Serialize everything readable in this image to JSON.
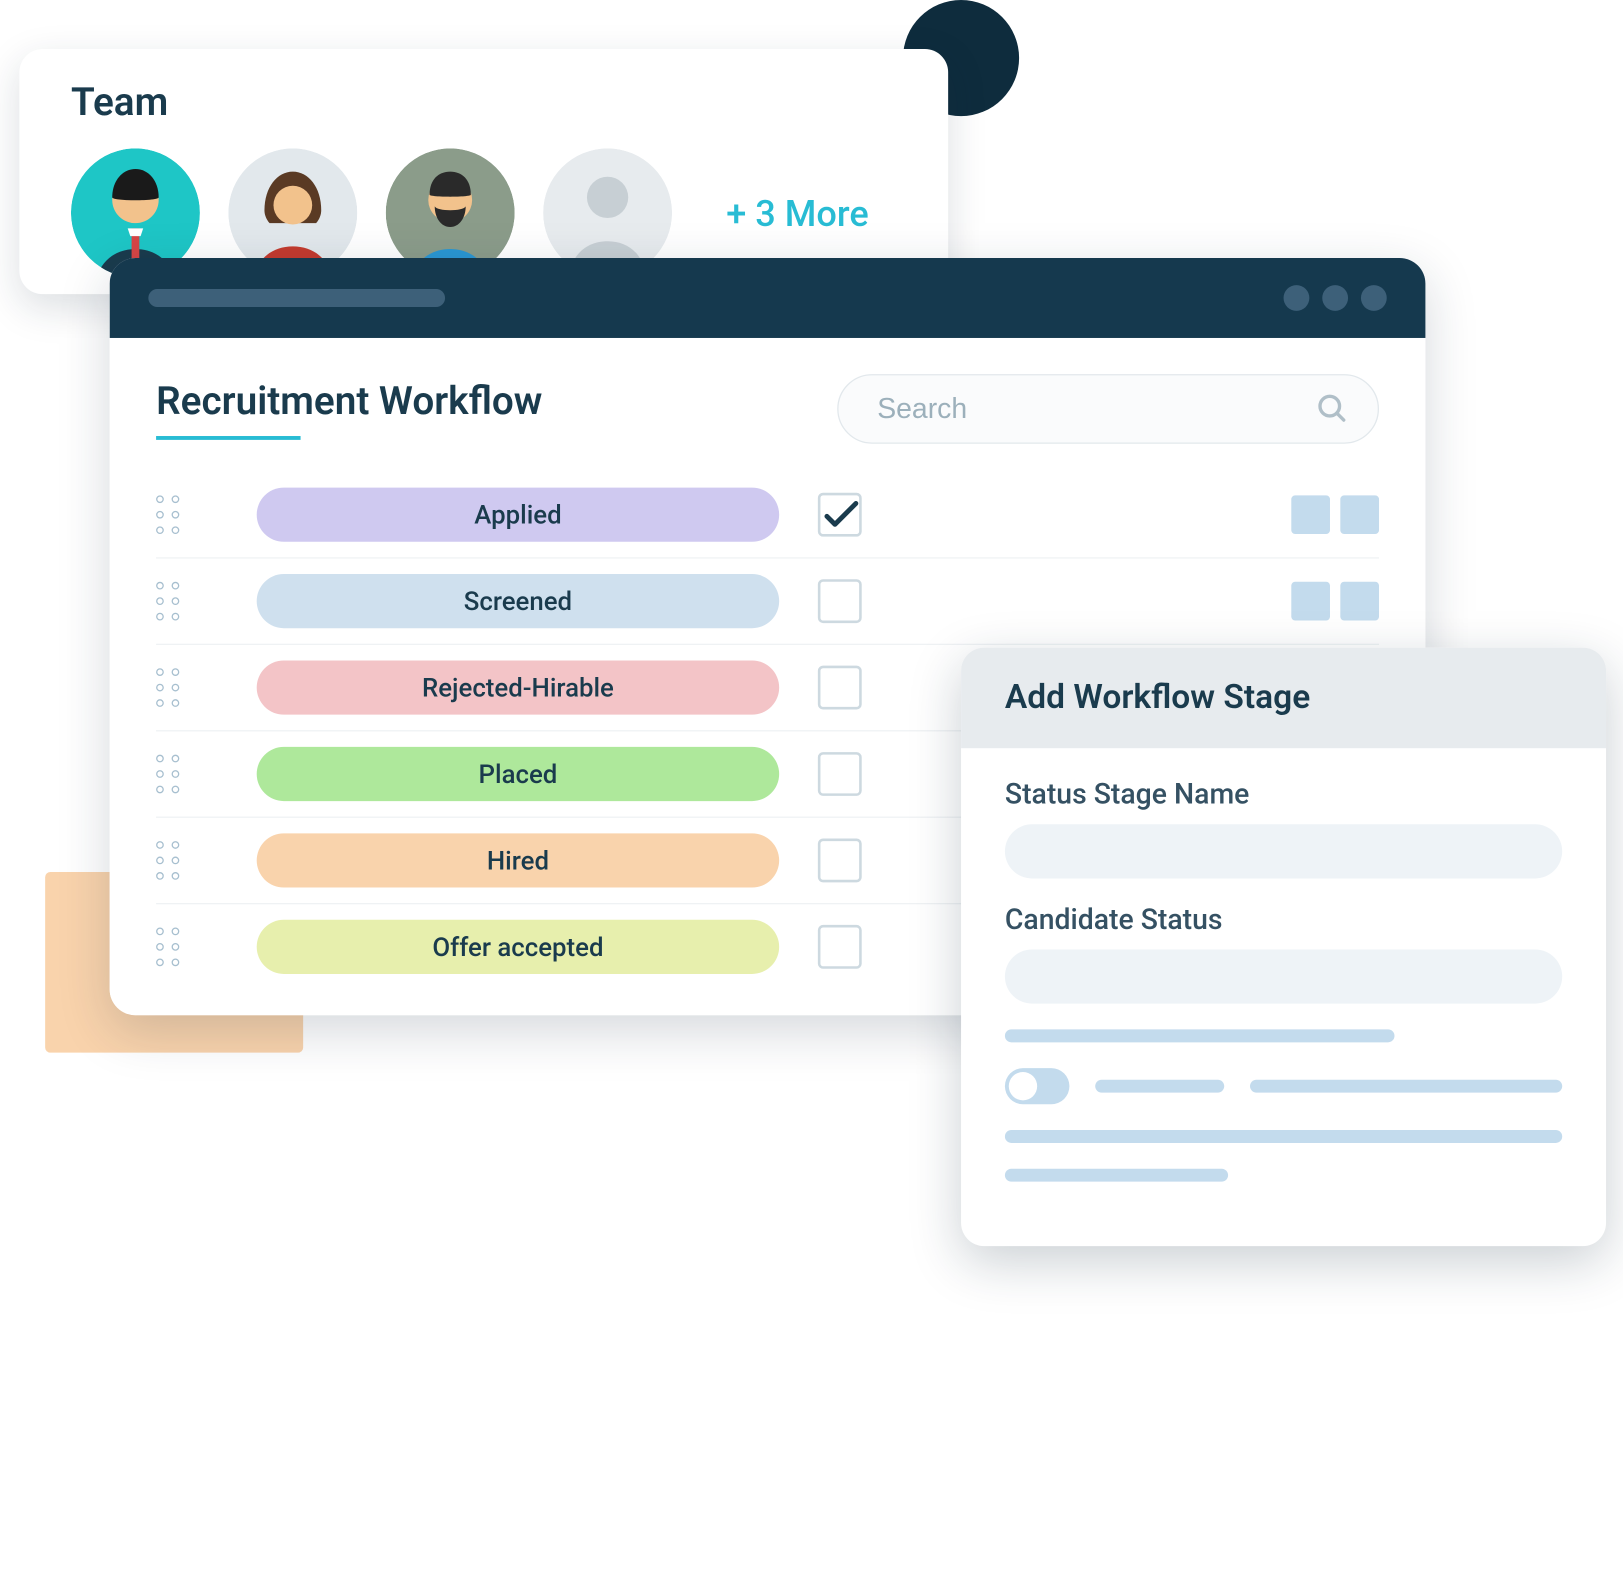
{
  "team": {
    "title": "Team",
    "more_label": "+ 3 More"
  },
  "workflow": {
    "title": "Recruitment Workflow",
    "search_placeholder": "Search",
    "stages": [
      {
        "label": "Applied",
        "color": "#cfc9f0",
        "checked": true
      },
      {
        "label": "Screened",
        "color": "#cfe0ee",
        "checked": false
      },
      {
        "label": "Rejected-Hirable",
        "color": "#f3c4c7",
        "checked": false
      },
      {
        "label": "Placed",
        "color": "#aee89b",
        "checked": false
      },
      {
        "label": "Hired",
        "color": "#f9d3ac",
        "checked": false
      },
      {
        "label": "Offer accepted",
        "color": "#e7efad",
        "checked": false
      }
    ]
  },
  "add_panel": {
    "title": "Add Workflow Stage",
    "stage_name_label": "Status Stage Name",
    "candidate_status_label": "Candidate Status"
  }
}
